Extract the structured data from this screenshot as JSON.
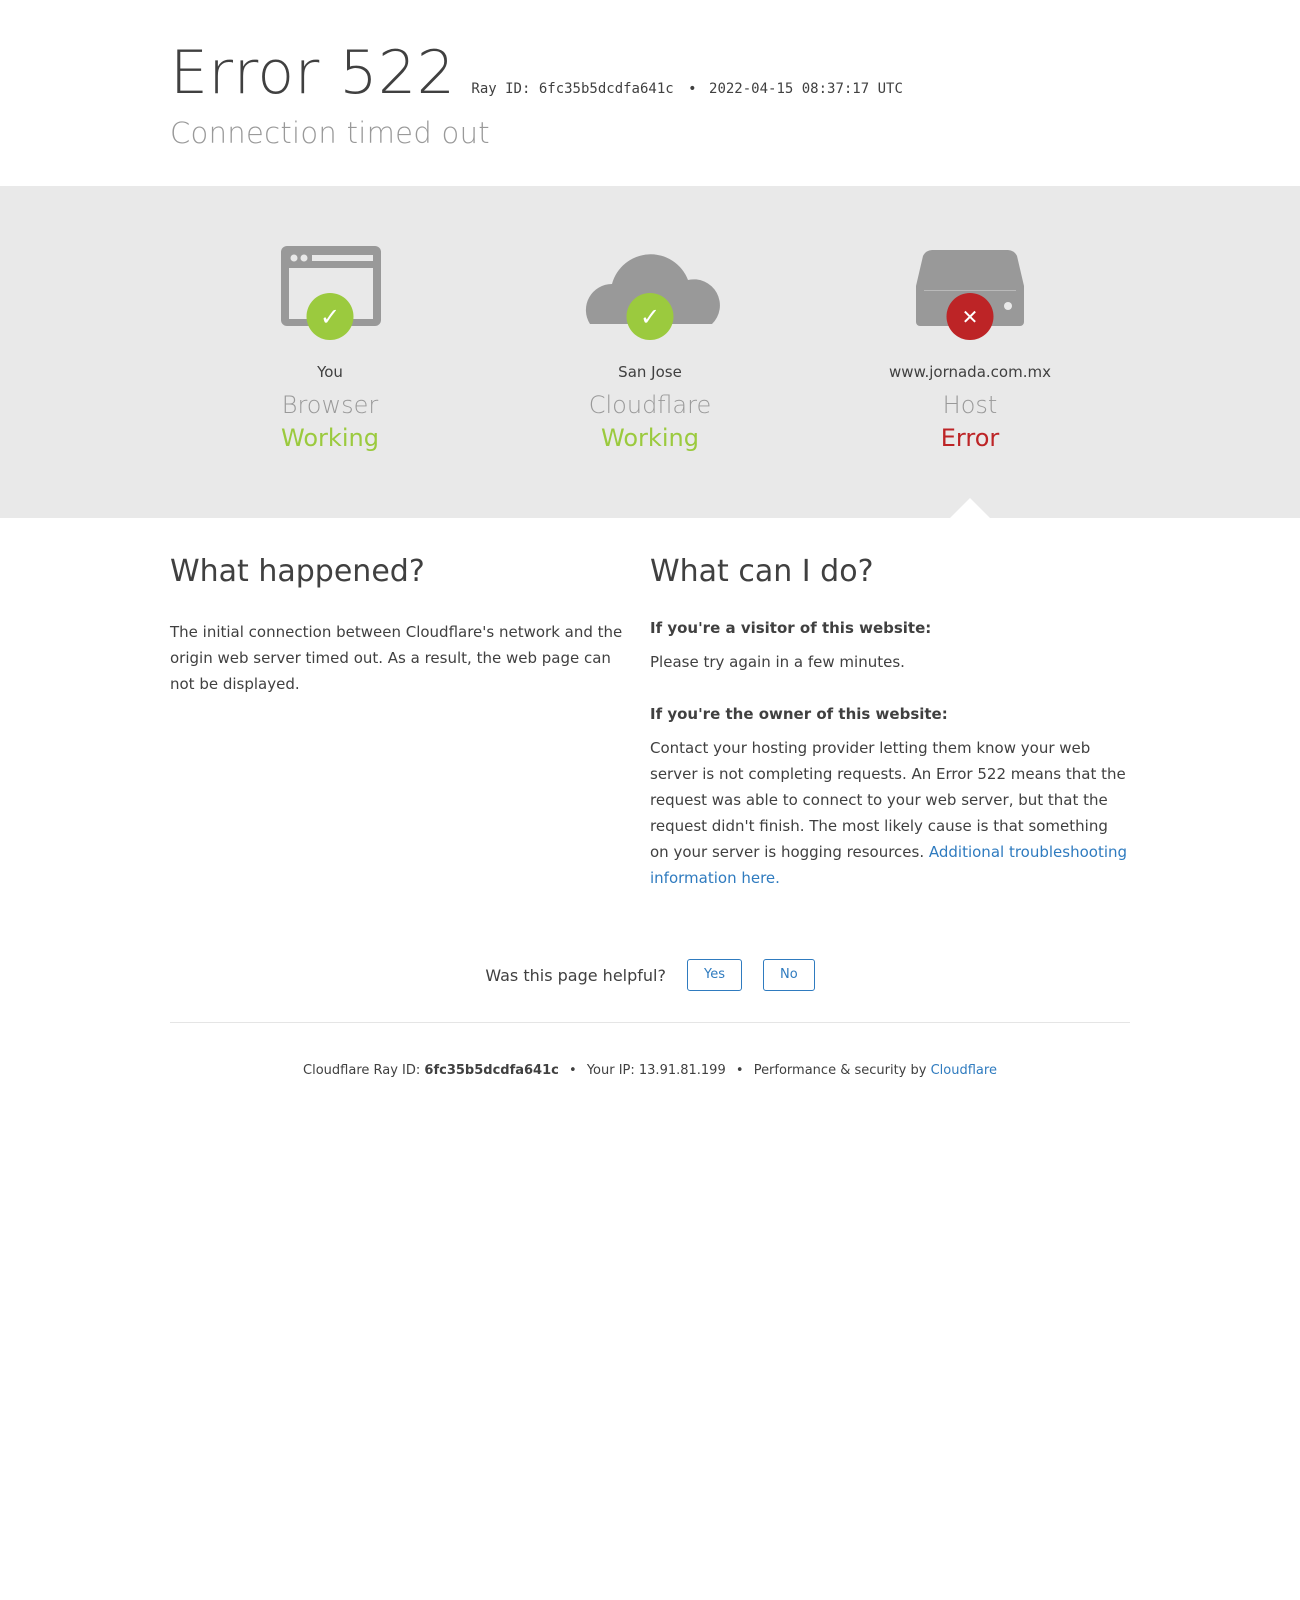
{
  "header": {
    "title": "Error 522",
    "ray_label": "Ray ID: 6fc35b5dcdfa641c",
    "bullet": "•",
    "timestamp": "2022-04-15 08:37:17 UTC",
    "subtitle": "Connection timed out"
  },
  "nodes": [
    {
      "location": "You",
      "role": "Browser",
      "status": "Working",
      "icon": "browser-icon",
      "badge": "✓"
    },
    {
      "location": "San Jose",
      "role": "Cloudflare",
      "status": "Working",
      "icon": "cloud-icon",
      "badge": "✓"
    },
    {
      "location": "www.jornada.com.mx",
      "role": "Host",
      "status": "Error",
      "icon": "server-icon",
      "badge": "✕"
    }
  ],
  "what_happened": {
    "heading": "What happened?",
    "body": "The initial connection between Cloudflare's network and the origin web server timed out. As a result, the web page can not be displayed."
  },
  "what_can_i_do": {
    "heading": "What can I do?",
    "visitor_lead": "If you're a visitor of this website:",
    "visitor_body": "Please try again in a few minutes.",
    "owner_lead": "If you're the owner of this website:",
    "owner_body": "Contact your hosting provider letting them know your web server is not completing requests. An Error 522 means that the request was able to connect to your web server, but that the request didn't finish. The most likely cause is that something on your server is hogging resources. ",
    "owner_link": "Additional troubleshooting information here."
  },
  "feedback": {
    "question": "Was this page helpful?",
    "yes": "Yes",
    "no": "No"
  },
  "footer": {
    "ray_label": "Cloudflare Ray ID:",
    "ray_id": "6fc35b5dcdfa641c",
    "ip_label": "Your IP:",
    "ip": "13.91.81.199",
    "perf_label": "Performance & security by",
    "brand_link": "Cloudflare",
    "bullet": "•"
  },
  "colors": {
    "ok": "#9bca3e",
    "error": "#bd2426",
    "link": "#2f7bbf",
    "icon_gray": "#999999",
    "band_bg": "#e9e9e9"
  }
}
